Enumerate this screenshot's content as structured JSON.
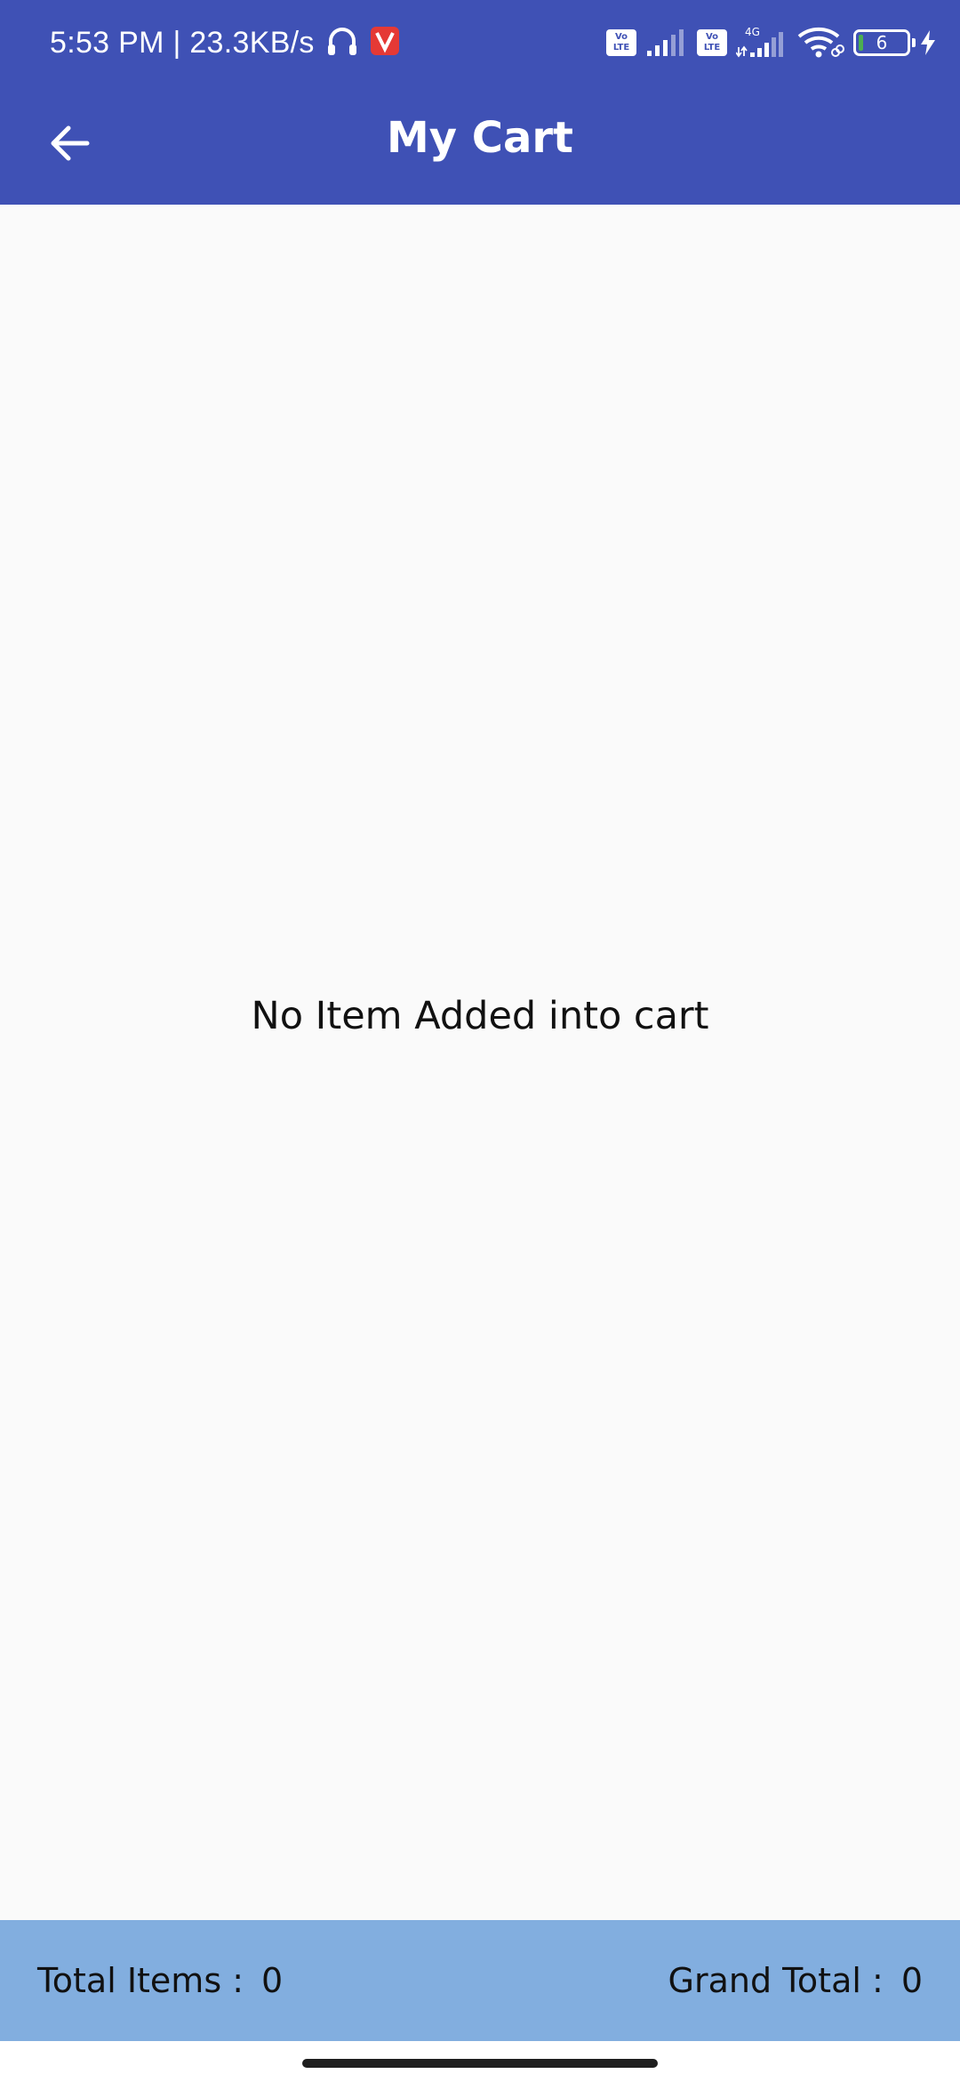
{
  "status_bar": {
    "time_and_speed": "5:53 PM | 23.3KB/s",
    "volte_label": "Vo\nLTE",
    "network_type": "4G",
    "battery_level": "6",
    "icons": [
      "headset-icon",
      "app-notification-icon",
      "volte-icon",
      "signal-icon",
      "volte-icon",
      "signal-4g-icon",
      "wifi-icon",
      "battery-icon",
      "charging-icon"
    ]
  },
  "app_bar": {
    "title": "My Cart",
    "back_icon": "arrow-back-icon"
  },
  "main": {
    "empty_message": "No Item Added into cart"
  },
  "footer": {
    "total_items_label": "Total Items :",
    "total_items_value": "0",
    "grand_total_label": "Grand Total :",
    "grand_total_value": "0"
  },
  "colors": {
    "primary": "#3f51b5",
    "footer_bg": "#82aedf",
    "background": "#fafafa",
    "text": "#111111"
  }
}
